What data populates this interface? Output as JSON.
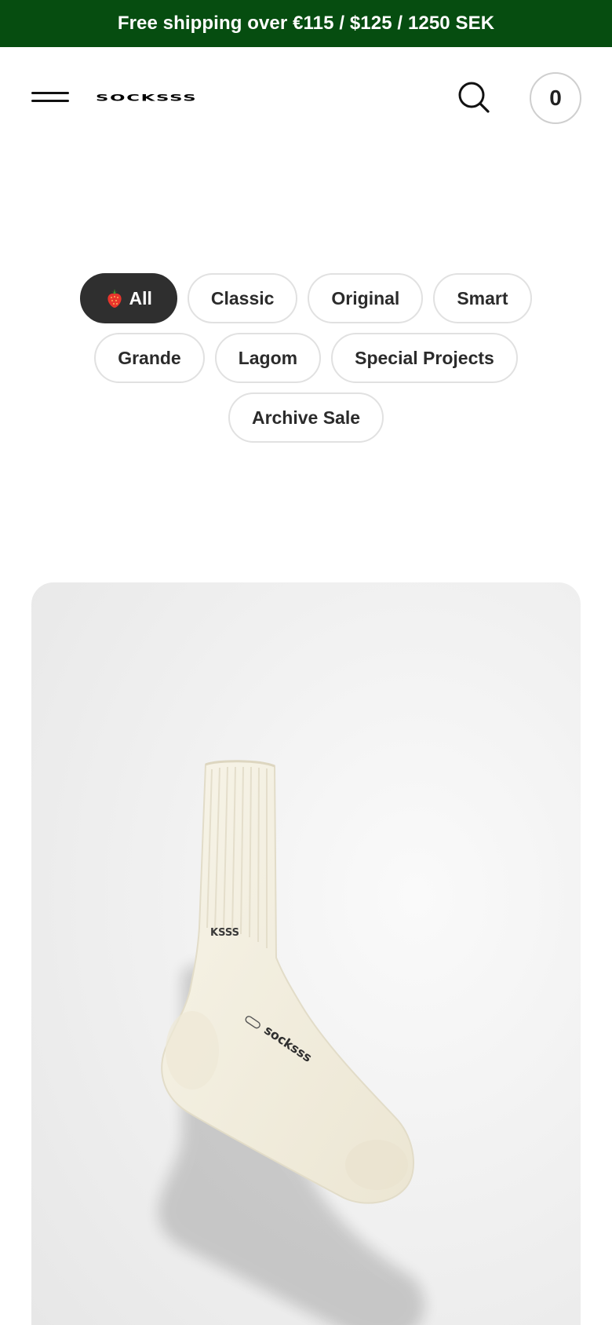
{
  "promo": {
    "text": "Free shipping over €115 / $125 / 1250 SEK"
  },
  "header": {
    "logo_text": "SOCKSSS",
    "cart_count": "0"
  },
  "filters": [
    {
      "label": "All",
      "active": true,
      "icon": "strawberry-icon"
    },
    {
      "label": "Classic",
      "active": false
    },
    {
      "label": "Original",
      "active": false
    },
    {
      "label": "Smart",
      "active": false
    },
    {
      "label": "Grande",
      "active": false
    },
    {
      "label": "Lagom",
      "active": false
    },
    {
      "label": "Special Projects",
      "active": false
    },
    {
      "label": "Archive Sale",
      "active": false
    }
  ],
  "product": {
    "image": "cream-ribbed-sock-photo",
    "printed_marks": [
      "KSSS",
      "socksss"
    ]
  },
  "colors": {
    "promo_bg": "#064d10",
    "active_chip_bg": "#2f2f2f",
    "chip_border": "#e1e1e1",
    "sock": "#f4f0e2"
  }
}
